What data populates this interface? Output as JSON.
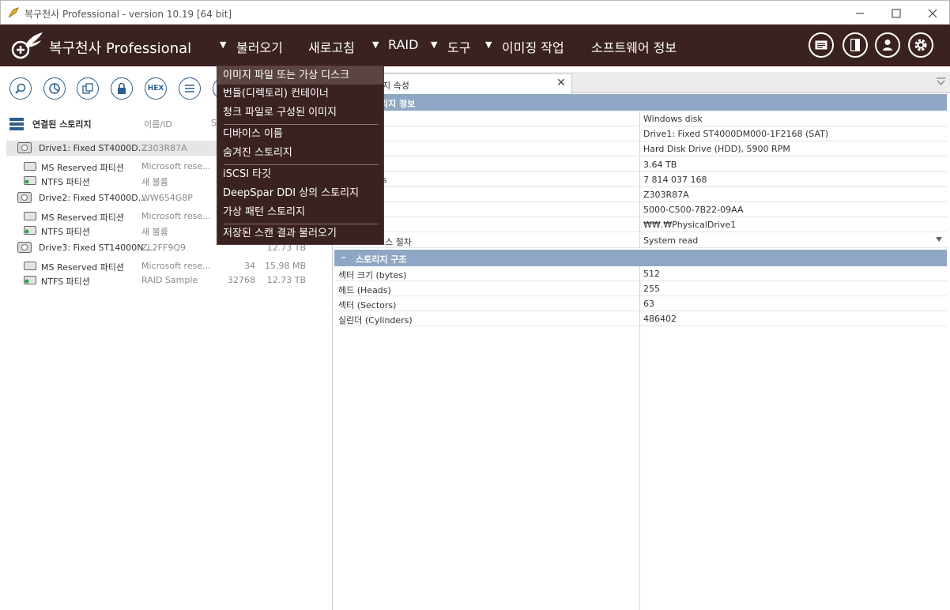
{
  "window": {
    "title": "복구천사 Professional - version 10.19 [64 bit]"
  },
  "menubar": {
    "brand": "복구천사 Professional",
    "items": [
      {
        "label": "불러오기",
        "arrow": "▼"
      },
      {
        "label": "새로고침",
        "arrow": ""
      },
      {
        "label": "RAID",
        "arrow": "▼"
      },
      {
        "label": "도구",
        "arrow": "▼"
      },
      {
        "label": "이미징 작업",
        "arrow": "▼"
      },
      {
        "label": "소프트웨어 정보",
        "arrow": ""
      }
    ],
    "icons": [
      "log-icon",
      "panel-icon",
      "user-icon",
      "settings-icon"
    ]
  },
  "toolbar": {
    "hex_label": "HEX"
  },
  "tree": {
    "header": {
      "title": "연결된 스토리지",
      "col_name": "이름/ID",
      "col_s": "S"
    },
    "rows": [
      {
        "label": "Drive1: Fixed ST4000D...",
        "name": "Z303R87A",
        "num": "",
        "size": "",
        "type": "drive",
        "selected": true
      },
      {
        "label": "MS Reserved 파티션",
        "name": "Microsoft rese...",
        "num": "",
        "size": "",
        "type": "partition"
      },
      {
        "label": "NTFS 파티션",
        "name": "새 볼륨",
        "num": "",
        "size": "",
        "type": "ntfs"
      },
      {
        "label": "Drive2: Fixed ST4000D...",
        "name": "WW654G8P",
        "num": "",
        "size": "",
        "type": "drive"
      },
      {
        "label": "MS Reserved 파티션",
        "name": "Microsoft rese...",
        "num": "",
        "size": "",
        "type": "partition"
      },
      {
        "label": "NTFS 파티션",
        "name": "새 볼륨",
        "num": "",
        "size": "",
        "type": "ntfs"
      },
      {
        "label": "Drive3: Fixed ST14000N...",
        "name": "ZL2FF9Q9",
        "num": "",
        "size": "12.73 TB",
        "type": "drive"
      },
      {
        "label": "MS Reserved 파티션",
        "name": "Microsoft rese...",
        "num": "34",
        "size": "15.98 MB",
        "type": "partition"
      },
      {
        "label": "NTFS 파티션",
        "name": "RAID Sample",
        "num": "32768",
        "size": "12.73 TB",
        "type": "ntfs"
      }
    ]
  },
  "tab": {
    "label": "지 속성",
    "close": "✕"
  },
  "properties": {
    "section1": "리지 정보",
    "rows1": [
      {
        "k": "",
        "v": "Windows disk"
      },
      {
        "k": "",
        "v": "Drive1: Fixed ST4000DM000-1F2168 (SAT)"
      },
      {
        "k": "",
        "v": "Hard Disk Drive (HDD), 5900 RPM"
      },
      {
        "k": "",
        "v": "3.64 TB"
      },
      {
        "k": "rs",
        "v": "7 814 037 168"
      },
      {
        "k": "",
        "v": "Z303R87A"
      },
      {
        "k": "",
        "v": "5000-C500-7B22-09AA"
      },
      {
        "k": "",
        "v": "₩₩.₩PhysicalDrive1"
      },
      {
        "k": "스 절차",
        "v": "System read"
      }
    ],
    "section2_toggle": "–",
    "section2": "스토리지 구조",
    "rows2": [
      {
        "k": "섹터 크기 (bytes)",
        "v": "512"
      },
      {
        "k": "헤드 (Heads)",
        "v": "255"
      },
      {
        "k": "섹터 (Sectors)",
        "v": "63"
      },
      {
        "k": "실린더 (Cylinders)",
        "v": "486402"
      }
    ]
  },
  "dropdown": {
    "items": [
      "이미지 파일 또는 가상 디스크",
      "번들(디렉토리) 컨테이너",
      "청크 파일로 구성된 이미지",
      "디바이스 이름",
      "숨겨진 스토리지",
      "iSCSI 타깃",
      "DeepSpar DDI 상의 스토리지",
      "가상 패턴 스토리지",
      "저장된 스캔 결과 불러오기"
    ]
  }
}
